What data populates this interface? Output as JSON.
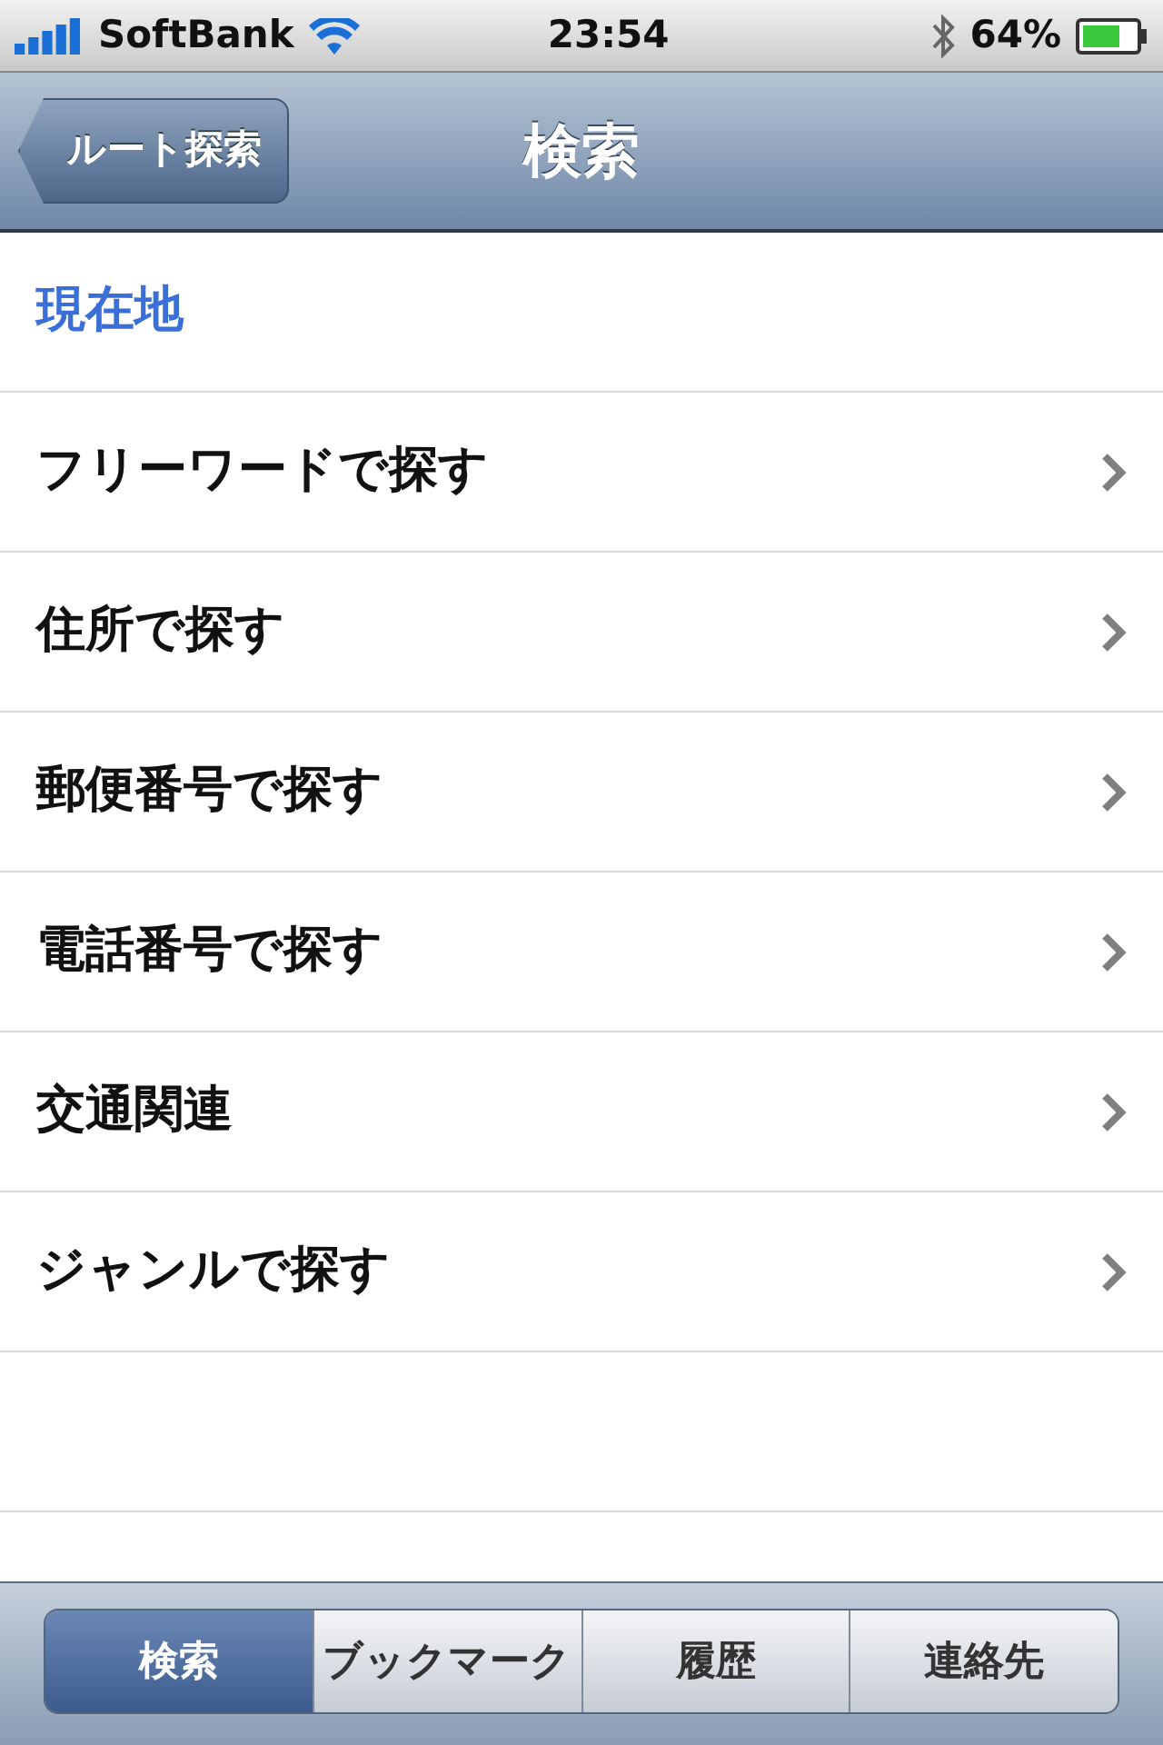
{
  "status_bar": {
    "carrier": "SoftBank",
    "time": "23:54",
    "battery": "64%"
  },
  "nav_bar": {
    "back": "ルート探索",
    "title": "検索"
  },
  "list": [
    {
      "label": "現在地",
      "kind": "action"
    },
    {
      "label": "フリーワードで探す",
      "kind": "link"
    },
    {
      "label": "住所で探す",
      "kind": "link"
    },
    {
      "label": "郵便番号で探す",
      "kind": "link"
    },
    {
      "label": "電話番号で探す",
      "kind": "link"
    },
    {
      "label": "交通関連",
      "kind": "link"
    },
    {
      "label": "ジャンルで探す",
      "kind": "link"
    }
  ],
  "segments": [
    {
      "label": "検索",
      "selected": true
    },
    {
      "label": "ブックマーク",
      "selected": false
    },
    {
      "label": "履歴",
      "selected": false
    },
    {
      "label": "連絡先",
      "selected": false
    }
  ]
}
